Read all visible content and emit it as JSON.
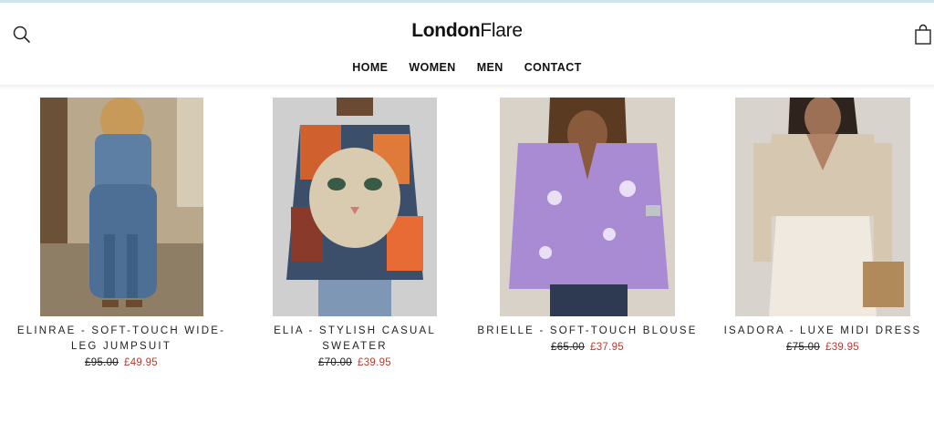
{
  "header": {
    "logo_bold": "London",
    "logo_light": "Flare",
    "search_icon": "search-icon",
    "cart_icon": "shopping-bag-icon"
  },
  "nav": [
    "HOME",
    "WOMEN",
    "MEN",
    "CONTACT"
  ],
  "products": [
    {
      "name": "ELINRAE - SOFT-TOUCH WIDE-LEG JUMPSUIT",
      "price_old": "£95.00",
      "price_new": "£49.95"
    },
    {
      "name": "ELIA - STYLISH CASUAL SWEATER",
      "price_old": "£70.00",
      "price_new": "£39.95"
    },
    {
      "name": "BRIELLE - SOFT-TOUCH BLOUSE",
      "price_old": "£65.00",
      "price_new": "£37.95"
    },
    {
      "name": "ISADORA - LUXE MIDI DRESS",
      "price_old": "£75.00",
      "price_new": "£39.95"
    }
  ],
  "colors": {
    "sale_price": "#c0392b",
    "text": "#111111",
    "top_rule": "#cfe3ea"
  }
}
